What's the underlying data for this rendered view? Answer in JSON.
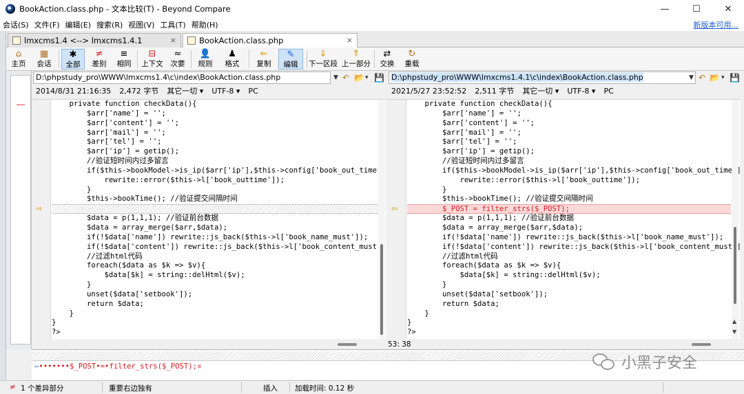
{
  "window": {
    "title": "BookAction.class.php - 文本比较(T) - Beyond Compare",
    "controls": {
      "minimize": "—",
      "maximize": "☐",
      "close": "✕"
    }
  },
  "menu": {
    "items": [
      "会话(S)",
      "文件(F)",
      "编辑(E)",
      "搜索(R)",
      "视图(V)",
      "工具(T)",
      "帮助(H)"
    ],
    "new_version_link": "新版本可用..."
  },
  "tabs": [
    {
      "label": "lmxcms1.4 <--> lmxcms1.4.1",
      "close": "×"
    },
    {
      "label": "BookAction.class.php",
      "close": "×"
    }
  ],
  "toolbar": {
    "buttons": [
      {
        "label": "主页",
        "icon": "⌂"
      },
      {
        "label": "会话",
        "icon": "▦"
      },
      {
        "label": "全部",
        "icon": "✱"
      },
      {
        "label": "差别",
        "icon": "≠"
      },
      {
        "label": "相同",
        "icon": "≡"
      },
      {
        "label": "上下文",
        "icon": "⊟"
      },
      {
        "label": "次要",
        "icon": "≈"
      },
      {
        "label": "规则",
        "icon": "👤"
      },
      {
        "label": "格式",
        "icon": "♟"
      },
      {
        "label": "复制",
        "icon": "⇐"
      },
      {
        "label": "编辑",
        "icon": "✎"
      },
      {
        "label": "下一区段",
        "icon": "⇓"
      },
      {
        "label": "上一部分",
        "icon": "⇑"
      },
      {
        "label": "交换",
        "icon": "⇄"
      },
      {
        "label": "重载",
        "icon": "↻"
      }
    ]
  },
  "left": {
    "path": "D:\\phpstudy_pro\\WWW\\lmxcms1.4\\c\\index\\BookAction.class.php",
    "date": "2014/8/31 21:16:35",
    "size": "2,472 字节",
    "other": "其它一切 ▾",
    "encoding": "UTF-8 ▾",
    "platform": "PC",
    "lines": [
      "    private function checkData(){",
      "        $arr['name'] = '';",
      "        $arr['content'] = '';",
      "        $arr['mail'] = '';",
      "        $arr['tel'] = '';",
      "        $arr['ip'] = getip();",
      "        //验证短时间内过多留言",
      "        if($this->bookModel->is_ip($arr['ip'],$this->config['book_out_time']) >",
      "            rewrite::error($this->l['book_outtime']);",
      "        }",
      "        $this->bookTime(); //验证提交间隔时间",
      "",
      "        $data = p(1,1,1); //验证前台数据",
      "        $data = array_merge($arr,$data);",
      "        if(!$data['name']) rewrite::js_back($this->l['book_name_must']);",
      "        if(!$data['content']) rewrite::js_back($this->l['book_content_must']);",
      "        //过滤html代码",
      "        foreach($data as $k => $v){",
      "            $data[$k] = string::delHtml($v);",
      "        }",
      "        unset($data['setbook']);",
      "        return $data;",
      "    }",
      "}",
      "?>"
    ]
  },
  "right": {
    "path": "D:\\phpstudy_pro\\WWW\\lmxcms1.4.1\\c\\index\\BookAction.class.php",
    "date": "2021/5/27 23:52:52",
    "size": "2,511 字节",
    "other": "其它一切 ▾",
    "encoding": "UTF-8 ▾",
    "platform": "PC",
    "lines": [
      "    private function checkData(){",
      "        $arr['name'] = '';",
      "        $arr['content'] = '';",
      "        $arr['mail'] = '';",
      "        $arr['tel'] = '';",
      "        $arr['ip'] = getip();",
      "        //验证短时间内过多留言",
      "        if($this->bookModel->is_ip($arr['ip'],$this->config['book_out_time']) >",
      "            rewrite::error($this->l['book_outtime']);",
      "        }",
      "        $this->bookTime(); //验证提交间隔时间",
      "        $_POST = filter_strs($_POST);",
      "        $data = p(1,1,1); //验证前台数据",
      "        $data = array_merge($arr,$data);",
      "        if(!$data['name']) rewrite::js_back($this->l['book_name_must']);",
      "        if(!$data['content']) rewrite::js_back($this->l['book_content_must']);",
      "        //过滤html代码",
      "        foreach($data as $k => $v){",
      "            $data[$k] = string::delHtml($v);",
      "        }",
      "        unset($data['setbook']);",
      "        return $data;",
      "    }",
      "}",
      "?>"
    ],
    "cursor_position": "53: 38"
  },
  "diff_index": 11,
  "detail_line": "•••••••$_POST•=•filter_strs($_POST);¤",
  "watermark": "小黑子安全",
  "status": {
    "diff_count": "1 个差异部分",
    "important": "重要右边独有",
    "mode": "插入",
    "load_time": "加载时间: 0.12 秒"
  },
  "colors": {
    "diff_bg": "#fbd8d8",
    "diff_text": "#d81b1b",
    "link": "#1a5fd0"
  }
}
